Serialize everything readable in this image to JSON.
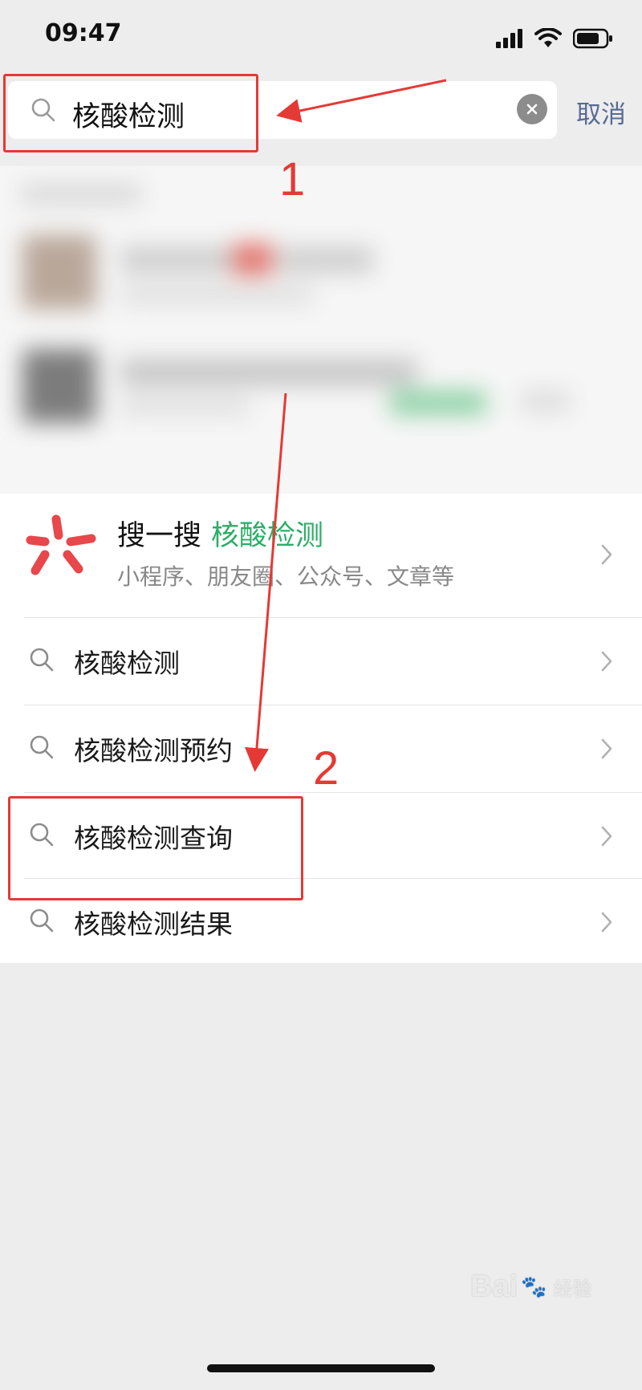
{
  "status_bar": {
    "time": "09:47"
  },
  "search": {
    "query": "核酸检测",
    "cancel_label": "取消"
  },
  "souyisou": {
    "label": "搜一搜",
    "keyword": "核酸检测",
    "subtitle": "小程序、朋友圈、公众号、文章等"
  },
  "suggestions": [
    {
      "label": "核酸检测"
    },
    {
      "label": "核酸检测预约"
    },
    {
      "label": "核酸检测查询"
    },
    {
      "label": "核酸检测结果"
    }
  ],
  "annotations": {
    "step1": "1",
    "step2": "2"
  },
  "watermark": {
    "brand": "Bai",
    "paw": "🐾",
    "suffix": "经验"
  },
  "colors": {
    "accent_green": "#2aae67",
    "link_blue": "#576b95",
    "annotation_red": "#e53935",
    "logo_red": "#e8474b"
  }
}
